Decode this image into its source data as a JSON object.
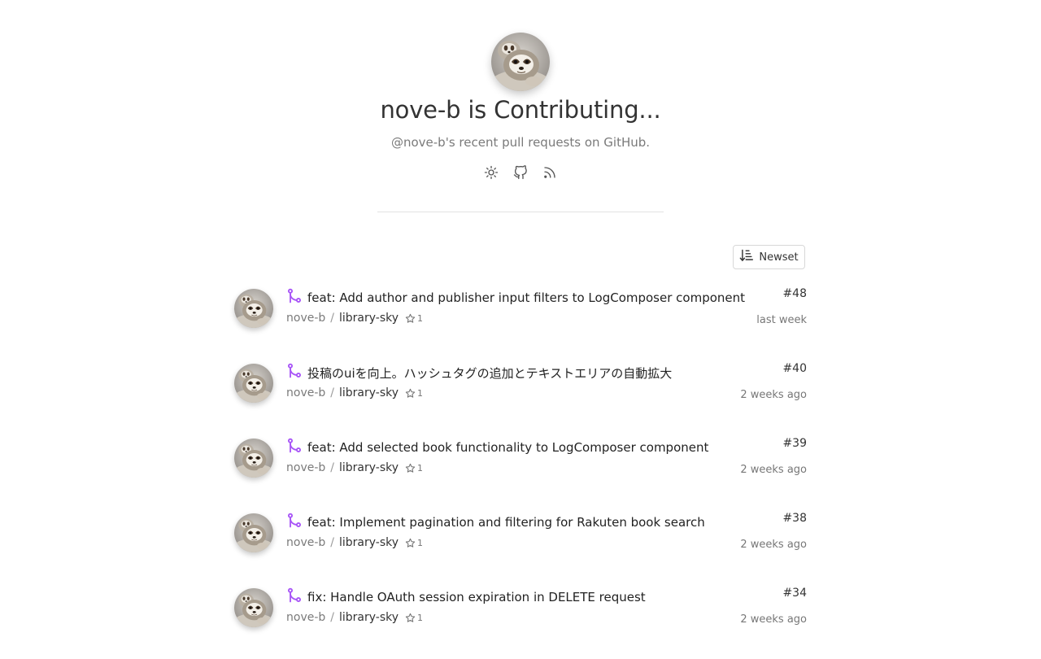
{
  "profile": {
    "title": "nove-b is Contributing...",
    "subtitle": "@nove-b's recent pull requests on GitHub."
  },
  "toolbar": {
    "icons": [
      "sun-icon",
      "github-icon",
      "rss-icon"
    ]
  },
  "sort": {
    "label": "Newset"
  },
  "colors": {
    "merge_icon": "#a855f7",
    "text": "#222222",
    "muted": "#7a7a7a"
  },
  "pull_requests": [
    {
      "title": "feat: Add author and publisher input filters to LogComposer component",
      "owner": "nove-b",
      "repo": "library-sky",
      "stars": "1",
      "number": "#48",
      "time": "last week"
    },
    {
      "title": "投稿のuiを向上。ハッシュタグの追加とテキストエリアの自動拡大",
      "owner": "nove-b",
      "repo": "library-sky",
      "stars": "1",
      "number": "#40",
      "time": "2 weeks ago"
    },
    {
      "title": "feat: Add selected book functionality to LogComposer component",
      "owner": "nove-b",
      "repo": "library-sky",
      "stars": "1",
      "number": "#39",
      "time": "2 weeks ago"
    },
    {
      "title": "feat: Implement pagination and filtering for Rakuten book search",
      "owner": "nove-b",
      "repo": "library-sky",
      "stars": "1",
      "number": "#38",
      "time": "2 weeks ago"
    },
    {
      "title": "fix: Handle OAuth session expiration in DELETE request",
      "owner": "nove-b",
      "repo": "library-sky",
      "stars": "1",
      "number": "#34",
      "time": "2 weeks ago"
    }
  ]
}
